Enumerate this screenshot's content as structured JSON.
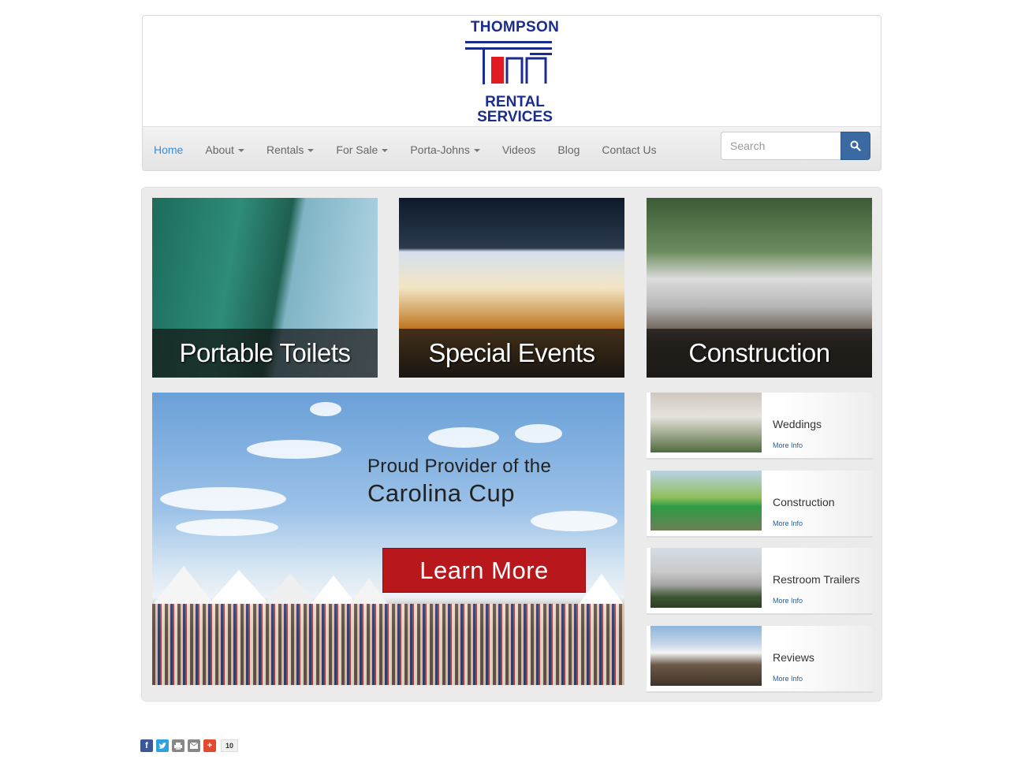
{
  "logo": {
    "line1": "THOMPSON",
    "line2": "RENTAL",
    "line3": "SERVICES"
  },
  "colors": {
    "brand_blue": "#1a2d8c",
    "brand_red": "#e21b23",
    "nav_active": "#428bca",
    "search_button": "#3b6aa3",
    "learn_more": "#b8171c"
  },
  "nav": {
    "items": [
      {
        "label": "Home",
        "active": true,
        "dropdown": false
      },
      {
        "label": "About",
        "dropdown": true
      },
      {
        "label": "Rentals",
        "dropdown": true
      },
      {
        "label": "For Sale",
        "dropdown": true
      },
      {
        "label": "Porta-Johns",
        "dropdown": true
      },
      {
        "label": "Videos",
        "dropdown": false
      },
      {
        "label": "Blog",
        "dropdown": false
      },
      {
        "label": "Contact Us",
        "dropdown": false
      }
    ],
    "search": {
      "placeholder": "Search",
      "icon": "search-icon"
    }
  },
  "tiles": [
    {
      "label": "Portable Toilets"
    },
    {
      "label": "Special Events"
    },
    {
      "label": "Construction"
    }
  ],
  "banner": {
    "line1": "Proud Provider of the",
    "line2": "Carolina Cup",
    "button": "Learn More"
  },
  "side_items": [
    {
      "title": "Weddings",
      "more": "More Info"
    },
    {
      "title": "Construction",
      "more": "More Info"
    },
    {
      "title": "Restroom Trailers",
      "more": "More Info"
    },
    {
      "title": "Reviews",
      "more": "More Info"
    }
  ],
  "share": {
    "buttons": [
      "facebook-icon",
      "twitter-icon",
      "print-icon",
      "email-icon",
      "more-share-icon"
    ],
    "count": "10"
  }
}
